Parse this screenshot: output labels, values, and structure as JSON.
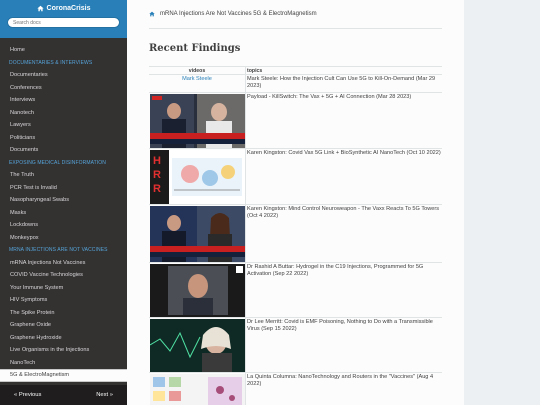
{
  "sidebar": {
    "brand": "CoronaCrisis",
    "search_placeholder": "Search docs",
    "home": "Home",
    "sections": [
      {
        "caption": "DOCUMENTARIES & INTERVIEWS",
        "items": [
          "Documentaries",
          "Conferences",
          "Interviews",
          "Nanotech",
          "Lawyers",
          "Politicians",
          "Documents"
        ]
      },
      {
        "caption": "EXPOSING MEDICAL DISINFORMATION",
        "items": [
          "The Truth",
          "PCR Test is Invalid",
          "Nasopharyngeal Swabs",
          "Masks",
          "Lockdowns",
          "Monkeypox"
        ]
      },
      {
        "caption": "MRNA INJECTIONS ARE NOT VACCINES",
        "items": [
          "mRNA Injections Not Vaccines",
          "COVID Vaccine Technologies",
          "Your Immune System",
          "HIV Symptoms",
          "The Spike Protein",
          "Graphene Oxide",
          "Graphene Hydroxide",
          "Live Organisms in the Injections",
          "NanoTech",
          "5G & ElectroMagnetism"
        ]
      }
    ],
    "prev_label": "« Previous",
    "next_label": "Next »"
  },
  "breadcrumb": "mRNA Injections Are Not Vaccines 5G & ElectroMagnetism",
  "page_title": "Recent Findings",
  "table": {
    "headers": [
      "videos",
      "topics"
    ],
    "rows": [
      {
        "video": "Mark Steele",
        "topic": "Mark Steele: How the Injection Cult Can Use 5G to Kill-On-Demand (Mar 29 2023)"
      },
      {
        "video": "",
        "topic": "Payload - KillSwitch: The Vax + 5G + AI Connection (Mar 28 2023)"
      },
      {
        "video": "",
        "topic": "Karen Kingston: Covid Vax 5G Link + BioSynthetic AI NanoTech (Oct 10 2022)"
      },
      {
        "video": "",
        "topic": "Karen Kingston: Mind Control Neuroweapon - The Vaxx Reacts To 5G Towers (Oct 4 2022)"
      },
      {
        "video": "",
        "topic": "Dr Rashid A Buttar: Hydrogel in the C19 Injections, Programmed for 5G Activation (Sep 22 2022)"
      },
      {
        "video": "",
        "topic": "Dr Lee Merritt: Covid is EMF Poisoning, Nothing to Do with a Transmissible Virus (Sep 15 2022)"
      },
      {
        "video": "",
        "topic": "La Quinta Columna: NanoTechnology and Routers in the \"Vaccines\" (Aug 4 2022)"
      }
    ]
  }
}
